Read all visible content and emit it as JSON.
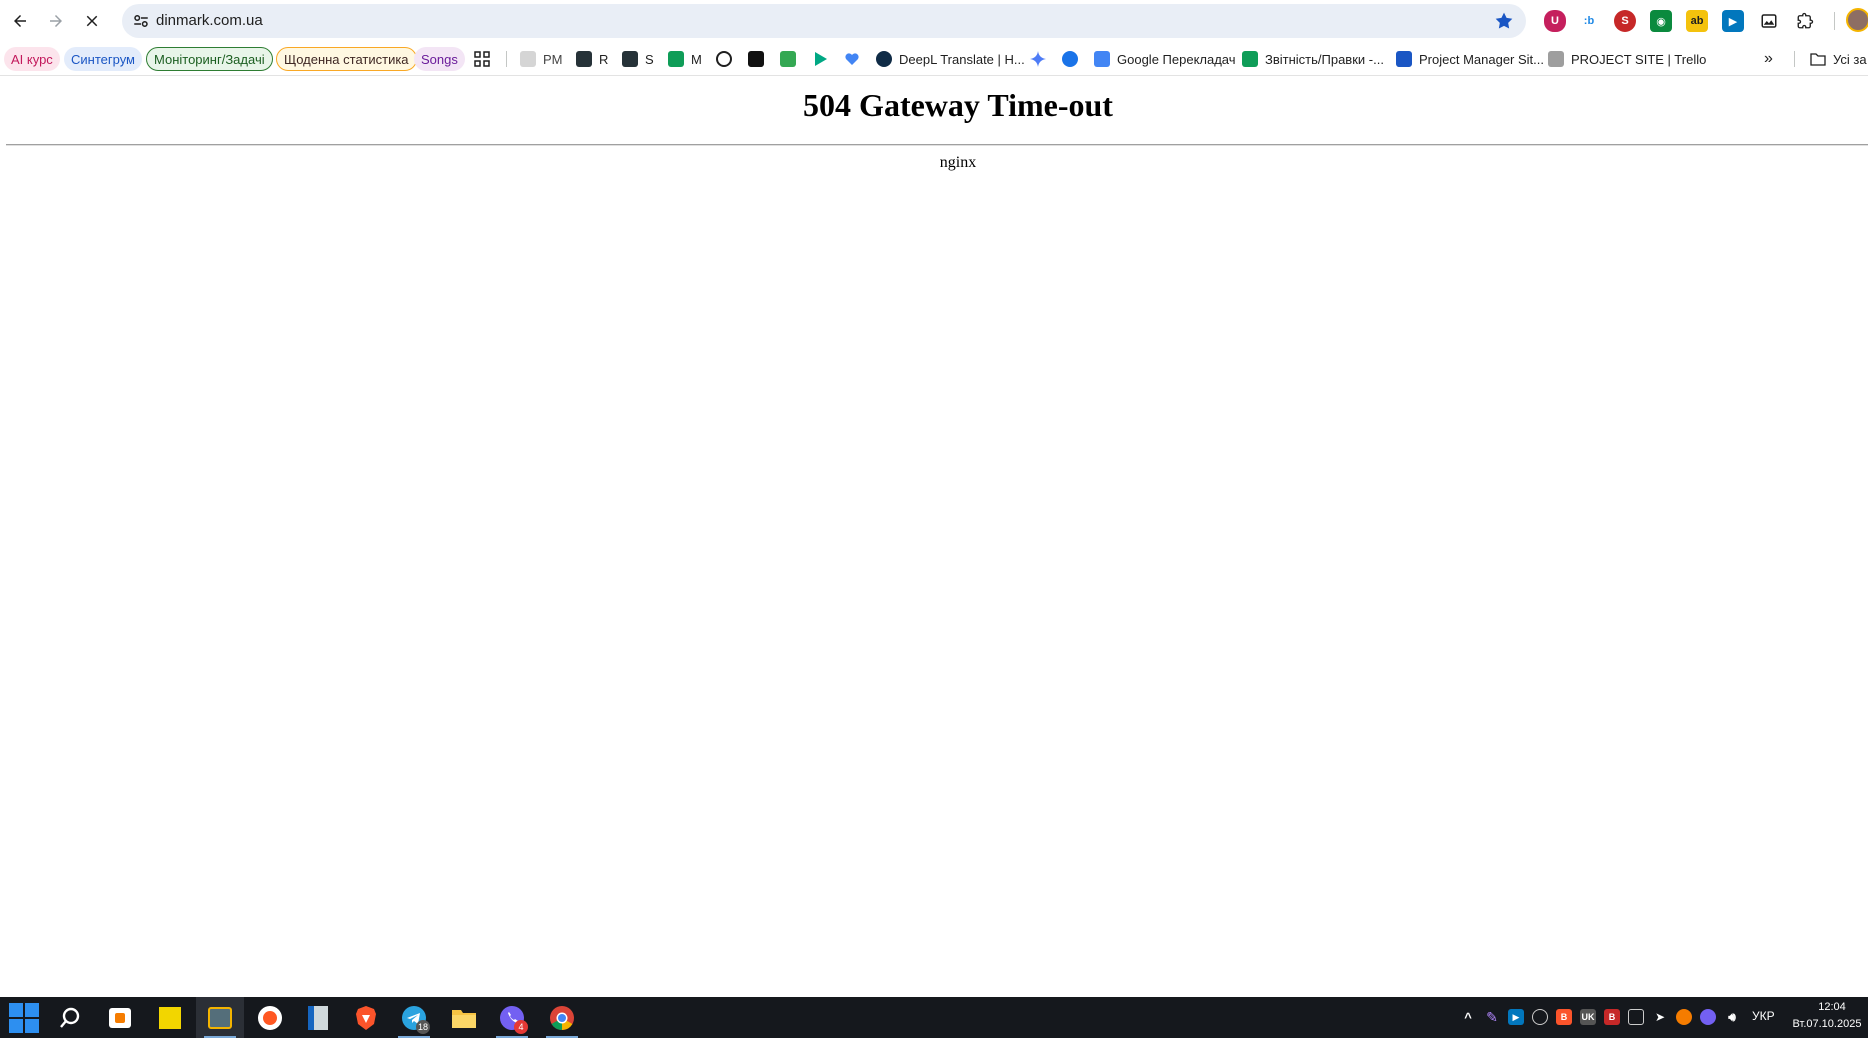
{
  "browser": {
    "url": "dinmark.com.ua",
    "extensions": [
      "ublock-icon",
      "bitwarden-icon",
      "extension-red-icon",
      "extension-green-icon",
      "extension-yellow-icon",
      "extension-blue-icon",
      "image-extension-icon",
      "extensions-puzzle-icon"
    ]
  },
  "bookmarks": {
    "pills": [
      {
        "label": "AI курс",
        "color": "#c2185b",
        "bg": "#fce4ec"
      },
      {
        "label": "Синтегрум",
        "color": "#1a56c4",
        "bg": "#e3ecfb"
      },
      {
        "label": "Моніторинг/Задачі",
        "color": "#1b5e20",
        "bg": "#e8f5e9"
      },
      {
        "label": "Щоденна статистика",
        "color": "#5d4037",
        "bg": "#fff8e1"
      },
      {
        "label": "Songs",
        "color": "#6a1b9a",
        "bg": "#f3e5f5"
      }
    ],
    "items": [
      {
        "label": "PM"
      },
      {
        "label": "R"
      },
      {
        "label": "S"
      },
      {
        "label": "M"
      },
      {
        "label": "DeepL Translate | H..."
      },
      {
        "label": "Google Перекладач"
      },
      {
        "label": "Звітність/Правки -..."
      },
      {
        "label": "Project Manager Sit..."
      },
      {
        "label": "PROJECT SITE | Trello"
      },
      {
        "label": "Усі за"
      }
    ]
  },
  "page": {
    "title": "504 Gateway Time-out",
    "server": "nginx"
  },
  "taskbar": {
    "apps": [
      "start-icon",
      "search-icon",
      "app-orange-icon",
      "sticky-notes-icon",
      "active-app-icon",
      "opera-icon",
      "document-icon",
      "brave-icon",
      "telegram-icon",
      "file-explorer-icon",
      "viber-icon",
      "chrome-icon"
    ],
    "telegram_badge": "18",
    "viber_badge": "4",
    "language": "УКР",
    "time": "12:04",
    "date": "Вт.07.10.2025"
  }
}
